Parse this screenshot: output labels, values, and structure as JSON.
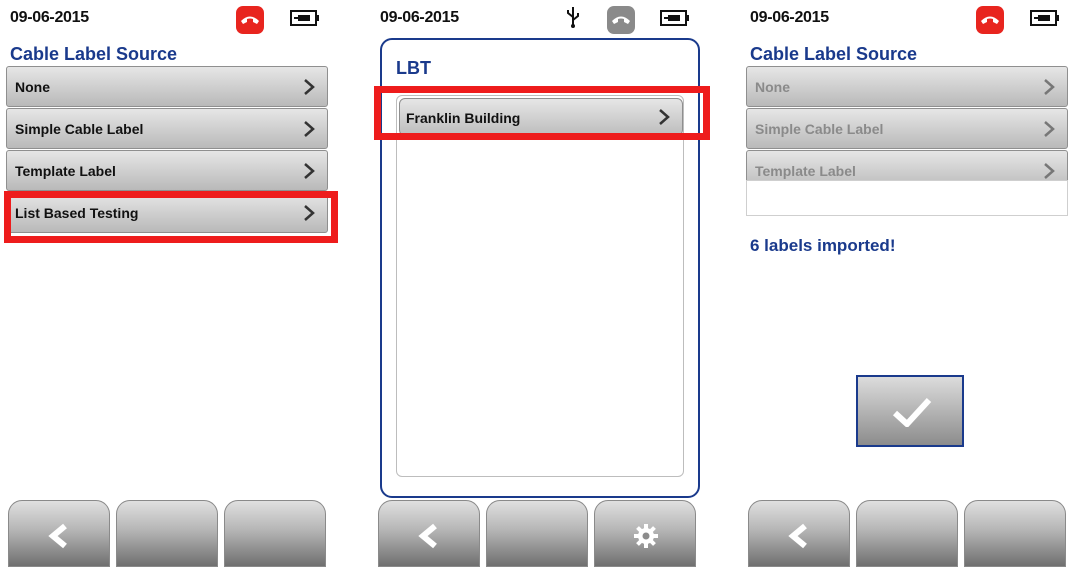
{
  "screens": [
    {
      "status": {
        "date": "09-06-2015",
        "hook_icon": "phone-hangup-icon",
        "hook_color": "#e8251f"
      },
      "title": "Cable Label Source",
      "items": [
        "None",
        "Simple Cable Label",
        "Template Label",
        "List Based Testing"
      ],
      "highlight": "List Based Testing",
      "softkeys": [
        "back-arrow-icon",
        "",
        ""
      ]
    },
    {
      "status": {
        "date": "09-06-2015",
        "usb_icon": "usb-icon",
        "hook_icon": "phone-hangup-icon",
        "hook_color": "#8a8a8a"
      },
      "title": "LBT",
      "items": [
        "Franklin Building"
      ],
      "highlight": "Franklin Building",
      "softkeys": [
        "back-arrow-icon",
        "",
        "gear-icon"
      ]
    },
    {
      "status": {
        "date": "09-06-2015",
        "hook_icon": "phone-hangup-icon",
        "hook_color": "#e8251f"
      },
      "title": "Cable Label Source",
      "items": [
        "None",
        "Simple Cable Label",
        "Template Label"
      ],
      "message": "6 labels imported!",
      "confirm_icon": "checkmark-icon",
      "softkeys": [
        "back-arrow-icon",
        "",
        ""
      ]
    }
  ],
  "colors": {
    "accent": "#1a3a8c",
    "highlight": "#ee1c1c",
    "hook_red": "#e8251f"
  }
}
